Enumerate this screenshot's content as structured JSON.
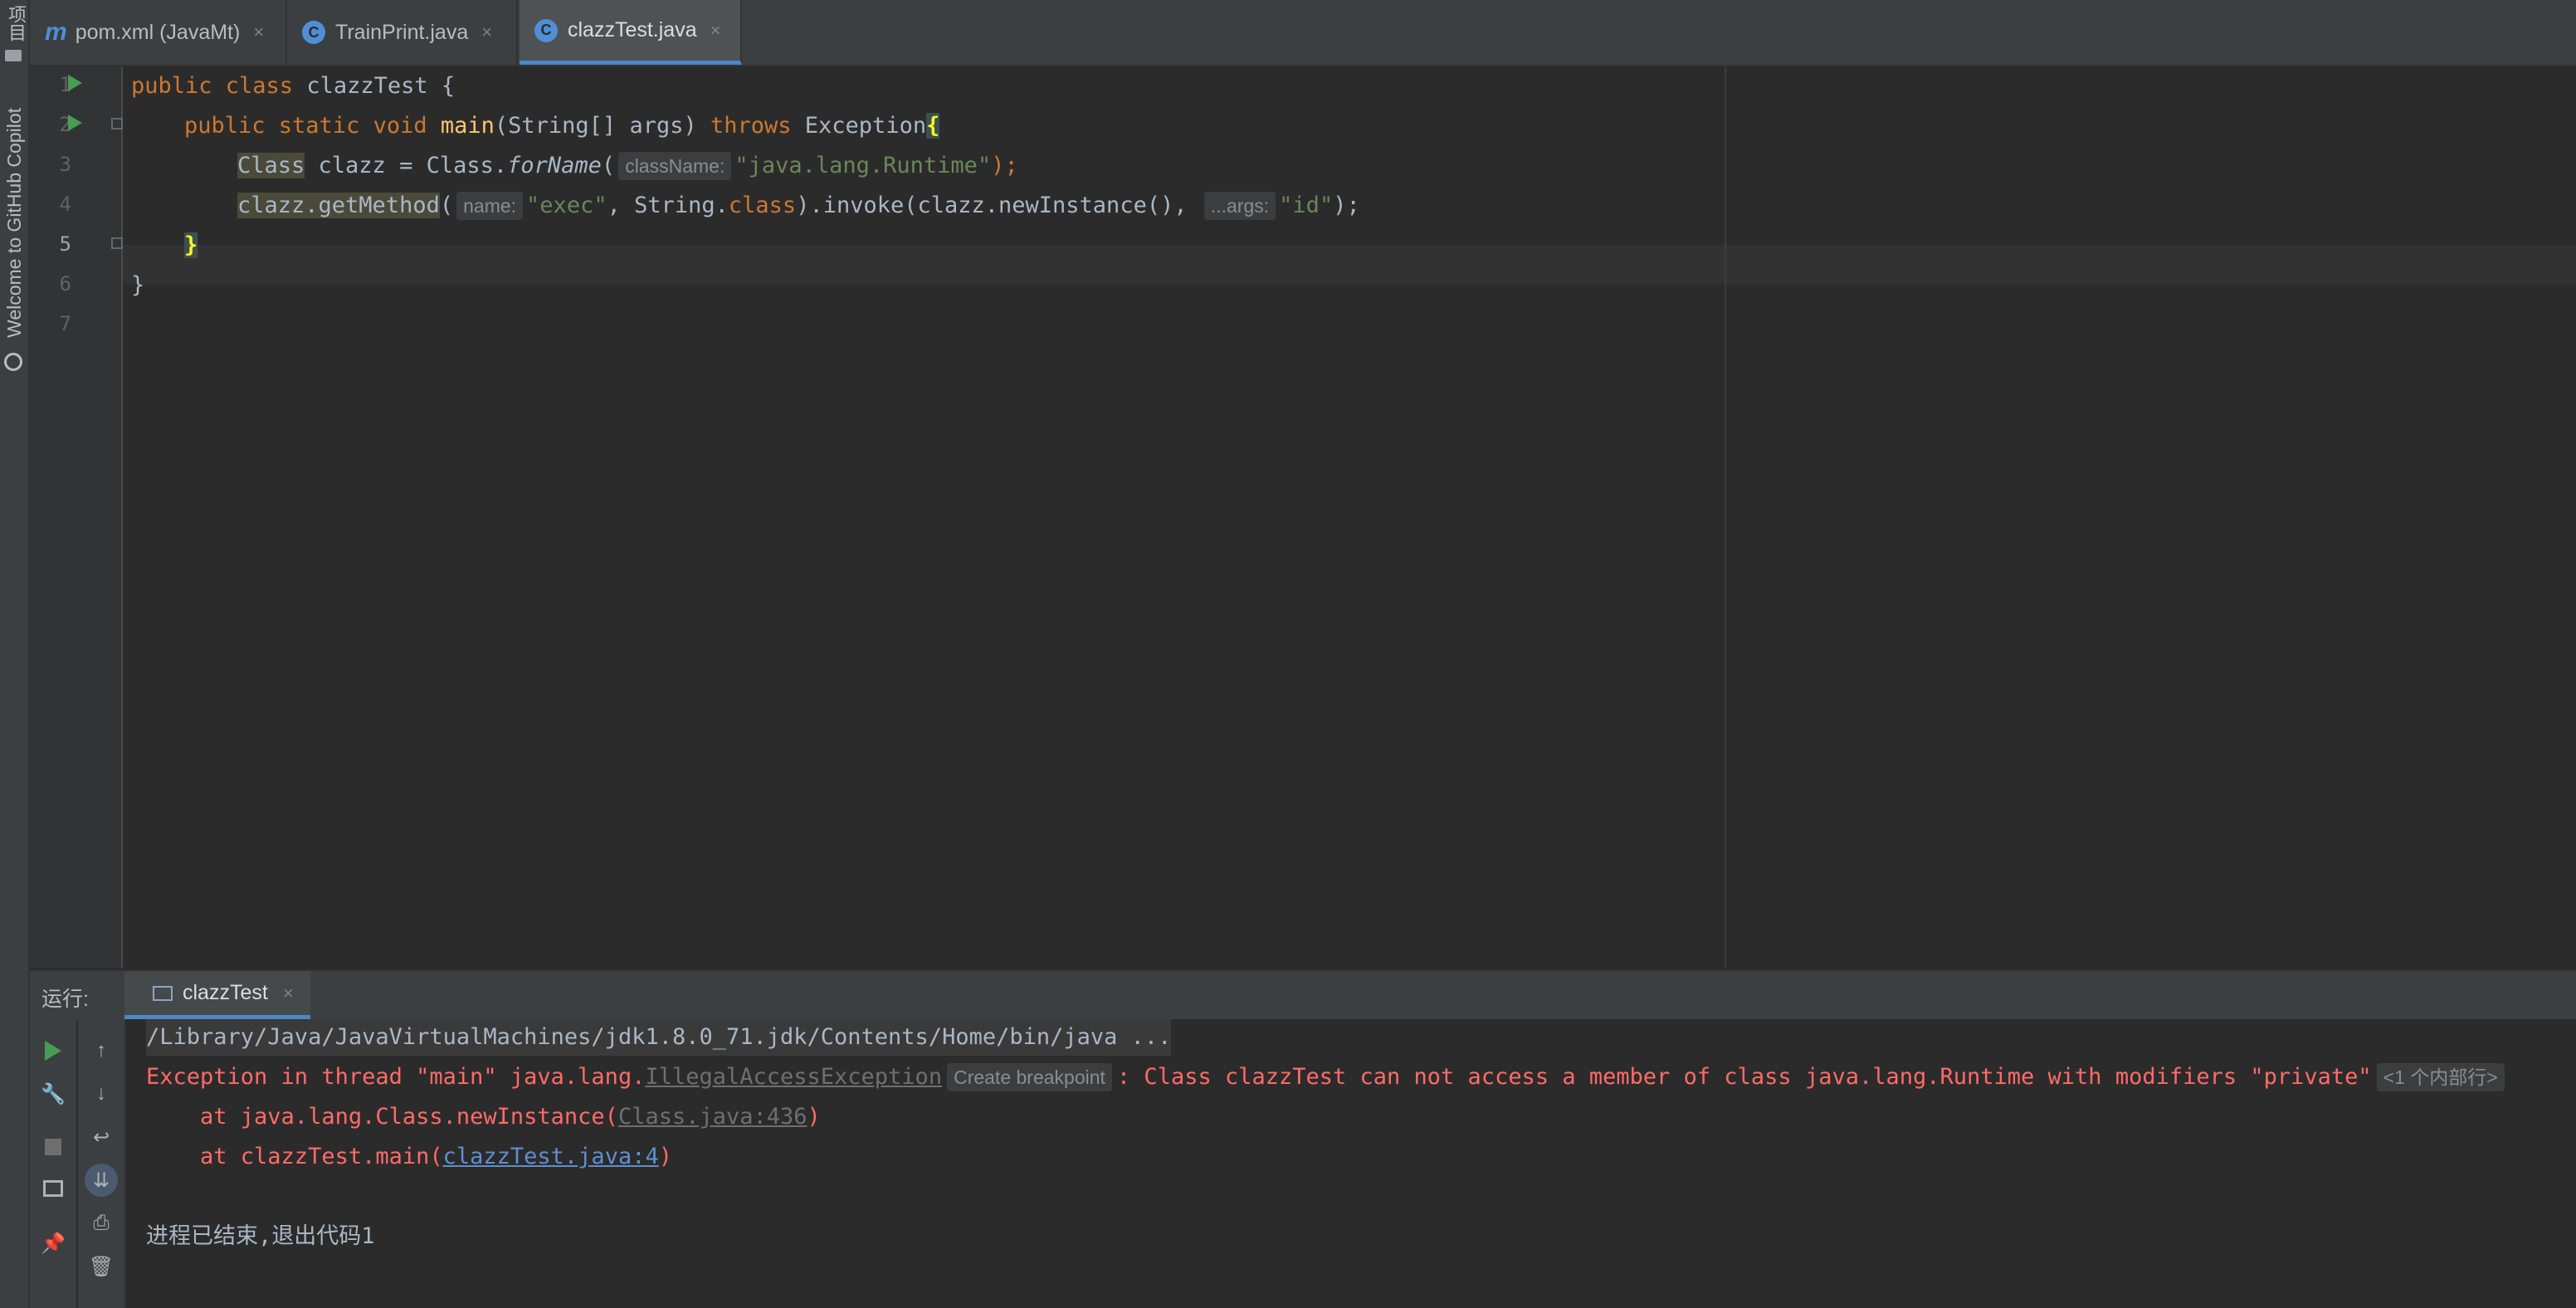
{
  "left_strip": {
    "project_label": "项目",
    "copilot_label": "Welcome to GitHub Copilot"
  },
  "tabs": [
    {
      "label": "pom.xml (JavaMt)",
      "icon": "maven-icon",
      "icon_glyph": "m",
      "active": false
    },
    {
      "label": "TrainPrint.java",
      "icon": "java-class-icon",
      "icon_glyph": "C",
      "active": false
    },
    {
      "label": "clazzTest.java",
      "icon": "java-class-icon",
      "icon_glyph": "C",
      "active": true
    }
  ],
  "tab_close_glyph": "×",
  "editor": {
    "line_numbers": [
      "1",
      "2",
      "3",
      "4",
      "5",
      "6",
      "7"
    ],
    "lines": {
      "l1_kw": "public class ",
      "l1_name": "clazzTest {",
      "l2_kw1": "public static void ",
      "l2_fn": "main",
      "l2_params": "(String[] args) ",
      "l2_kw2": "throws ",
      "l2_exc": "Exception",
      "l2_brace": "{",
      "l3_type": "Class",
      "l3_mid": " clazz = Class.",
      "l3_method": "forName",
      "l3_paren": "(",
      "l3_hint": "className:",
      "l3_str": "\"java.lang.Runtime\"",
      "l3_end": ");",
      "l4_call": "clazz.getMethod",
      "l4_paren": "(",
      "l4_hint1": "name:",
      "l4_str1": "\"exec\"",
      "l4_mid1": ", String.",
      "l4_kw": "class",
      "l4_mid2": ").invoke(clazz.newInstance(), ",
      "l4_hint2": "...args:",
      "l4_str2": "\"id\"",
      "l4_end": ");",
      "l5": "}",
      "l6": "}"
    }
  },
  "run_panel": {
    "title": "运行:",
    "tab_label": "clazzTest",
    "console": {
      "cmd": "/Library/Java/JavaVirtualMachines/jdk1.8.0_71.jdk/Contents/Home/bin/java ...",
      "err_prefix": "Exception in thread \"main\" java.lang.",
      "err_link": "IllegalAccessException",
      "err_hint": "Create breakpoint",
      "err_msg": ": Class clazzTest can not access a member of class java.lang.Runtime with modifiers \"private\"",
      "err_internal": "<1 个内部行>",
      "trace1_prefix": "    at java.lang.Class.newInstance(",
      "trace1_link": "Class.java:436",
      "trace1_end": ")",
      "trace2_prefix": "    at clazzTest.main(",
      "trace2_link": "clazzTest.java:4",
      "trace2_end": ")",
      "exit_msg": "进程已结束,退出代码1"
    }
  },
  "colors": {
    "keyword": "#cc7832",
    "string": "#6a8759",
    "function": "#ffc66d",
    "error": "#ff6b68",
    "accent": "#4a88c7"
  }
}
